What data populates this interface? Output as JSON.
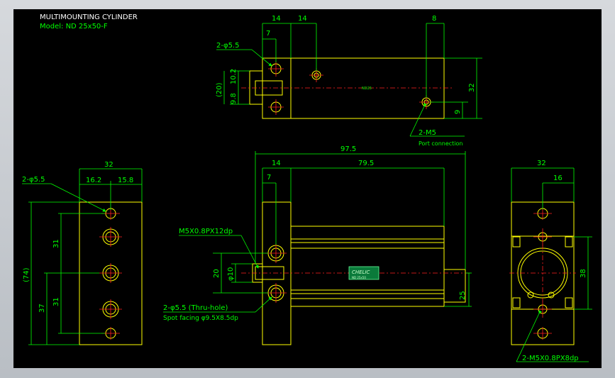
{
  "title": {
    "line1": "MULTIMOUNTING CYLINDER",
    "line2": "Model: ND 25x50-F"
  },
  "top_view": {
    "dims": {
      "d14a": "14",
      "d14b": "14",
      "d8": "8",
      "d7": "7",
      "d10_2": "10.2",
      "d9_8": "9.8",
      "d20p": "(20)",
      "d32": "32",
      "d9": "9"
    },
    "holes_label": "2-φ5.5",
    "port_label": "2-M5",
    "port_caption": "Port connection",
    "rod_text": "ND25"
  },
  "left_view": {
    "dims": {
      "d32": "32",
      "d16_2": "16.2",
      "d15_8": "15.8",
      "d31a": "31",
      "d31b": "31",
      "d37": "37",
      "d74": "(74)"
    },
    "holes_label": "2-φ5.5"
  },
  "front_view": {
    "dims": {
      "d97_5": "97.5",
      "d14": "14",
      "d79_5": "79.5",
      "d7": "7",
      "d20": "20",
      "dphi10": "φ10",
      "d25": "25"
    },
    "thread_label": "M5X0.8PX12dp",
    "hole_label": "2-φ5.5 (Thru-hole)",
    "spot_label": "Spot facing  φ9.5X8.5dp",
    "plate_text": "CHELIC",
    "plate_sub": "ND 25x50"
  },
  "right_view": {
    "dims": {
      "d32": "32",
      "d16": "16",
      "d38": "38"
    },
    "thread_label": "2-M5X0.8PX8dp"
  },
  "colors": {
    "outline": "#ffff00",
    "dimension": "#00ff00",
    "centerline": "#ff2020",
    "background": "#000000"
  }
}
